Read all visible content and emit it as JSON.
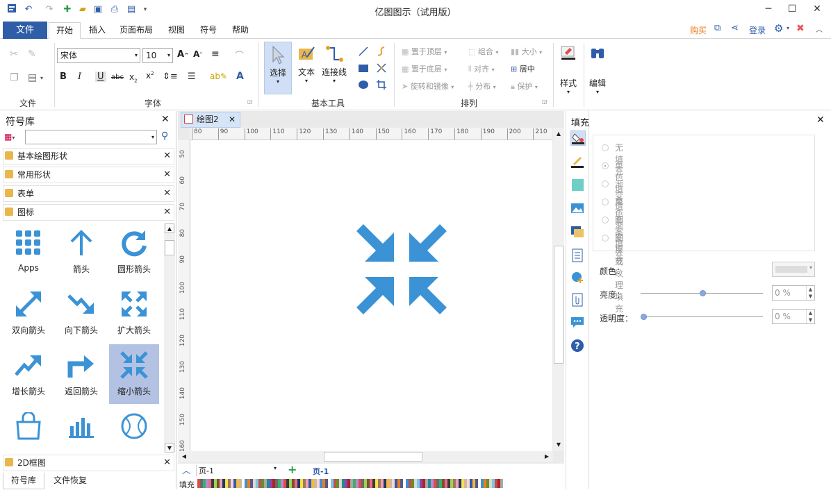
{
  "app": {
    "title": "亿图图示（试用版）"
  },
  "menu": {
    "file": "文件",
    "tabs": [
      "开始",
      "插入",
      "页面布局",
      "视图",
      "符号",
      "帮助"
    ],
    "right": {
      "buy": "购买",
      "login": "登录"
    }
  },
  "ribbon": {
    "groups": {
      "file": "文件",
      "font": "字体",
      "basic_tools": "基本工具",
      "arrange": "排列"
    },
    "font_name": "宋体",
    "font_size": "10",
    "tools": {
      "select": "选择",
      "text": "文本",
      "connector": "连接线"
    },
    "arrange": {
      "bring_front": "置于顶层",
      "send_back": "置于底层",
      "rotate": "旋转和镜像",
      "group": "组合",
      "align": "对齐",
      "distribute": "分布",
      "size": "大小",
      "center": "居中",
      "protect": "保护"
    },
    "style": "样式",
    "edit": "编辑"
  },
  "left": {
    "title": "符号库",
    "search_placeholder": "",
    "libraries": [
      "基本绘图形状",
      "常用形状",
      "表单",
      "图标"
    ],
    "icons": [
      {
        "label": "Apps",
        "icon": "apps-icon"
      },
      {
        "label": "箭头",
        "icon": "arrow-up-icon"
      },
      {
        "label": "圆形箭头",
        "icon": "circular-arrow-icon"
      },
      {
        "label": "双向箭头",
        "icon": "double-arrow-icon"
      },
      {
        "label": "向下箭头",
        "icon": "trend-down-icon"
      },
      {
        "label": "扩大箭头",
        "icon": "expand-arrows-icon"
      },
      {
        "label": "增长箭头",
        "icon": "trend-up-icon"
      },
      {
        "label": "返回箭头",
        "icon": "return-arrow-icon"
      },
      {
        "label": "缩小箭头",
        "icon": "shrink-arrows-icon"
      },
      {
        "label": "",
        "icon": "shopping-bag-icon"
      },
      {
        "label": "",
        "icon": "bar-chart-icon"
      },
      {
        "label": "",
        "icon": "baseball-icon"
      }
    ],
    "bottom_library": "2D框图",
    "bottom_tabs": [
      "符号库",
      "文件恢复"
    ]
  },
  "canvas": {
    "doc_tab": "绘图2",
    "hruler": [
      "80",
      "90",
      "100",
      "110",
      "120",
      "130",
      "140",
      "150",
      "160",
      "170",
      "180",
      "190",
      "200",
      "210"
    ],
    "vruler": [
      "50",
      "60",
      "70",
      "80",
      "90",
      "100",
      "110",
      "120",
      "130",
      "140",
      "150",
      "160"
    ],
    "page_select": "页-1",
    "page_tab": "页-1",
    "fill_label": "填充"
  },
  "right": {
    "title": "填充",
    "options": [
      "无填充",
      "单色填充",
      "渐变填充",
      "单色渐变填充",
      "图案填充",
      "图片或纹理填充"
    ],
    "selected": "单色填充",
    "color_label": "颜色：",
    "brightness_label": "亮度：",
    "brightness_value": "0 %",
    "transparency_label": "透明度：",
    "transparency_value": "0 %"
  },
  "colors": {
    "accent": "#2f5da8",
    "icon_blue": "#3b93d6",
    "buy": "#ee7c1b",
    "selected_cell": "#b3c2e3"
  }
}
